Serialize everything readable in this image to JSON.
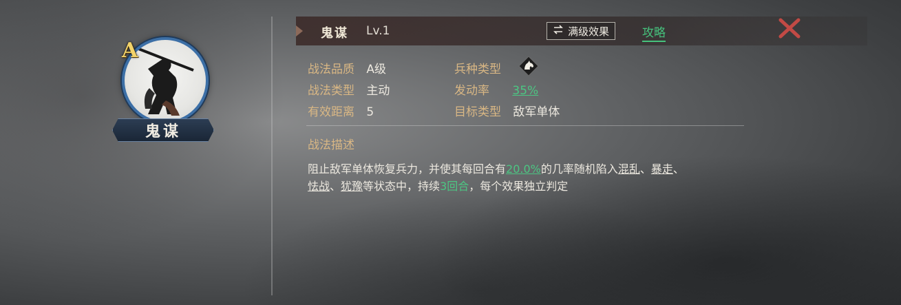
{
  "skill": {
    "name": "鬼谋",
    "level": "Lv.1",
    "grade": "A"
  },
  "header": {
    "max_effect_label": "满级效果",
    "guide_label": "攻略"
  },
  "info": {
    "quality_label": "战法品质",
    "quality_value": "A级",
    "type_label": "战法类型",
    "type_value": "主动",
    "range_label": "有效距离",
    "range_value": "5",
    "troop_label": "兵种类型",
    "rate_label": "发动率",
    "rate_value": "35%",
    "target_label": "目标类型",
    "target_value": "敌军单体"
  },
  "description": {
    "title": "战法描述",
    "p1": "阻止敌军单体恢复兵力，并使其每回合有",
    "chance": "20.0%",
    "p2": "的几率随机陷入",
    "s1": "混乱",
    "sep1": "、",
    "s2": "暴走",
    "sep2": "、",
    "s3": "怯战",
    "sep3": "、",
    "s4": "犹豫",
    "p3": "等状态中，持续",
    "duration": "3回合",
    "p4": "，每个效果独立判定"
  },
  "colors": {
    "accent_green": "#4cc683",
    "label_gold": "#d9b784",
    "grade_yellow": "#f3d36a",
    "close_red": "#c24a45"
  },
  "icons": {
    "close": "close-icon",
    "swap": "swap-icon",
    "troop": "cavalry-horse-icon"
  }
}
